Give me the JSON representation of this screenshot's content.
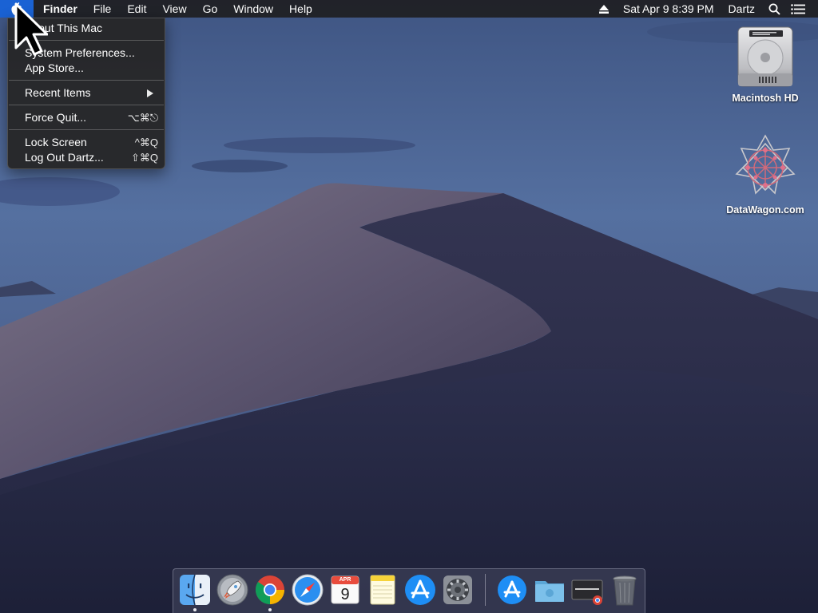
{
  "menubar": {
    "app_name": "Finder",
    "menus": [
      "File",
      "Edit",
      "View",
      "Go",
      "Window",
      "Help"
    ],
    "datetime": "Sat Apr 9  8:39 PM",
    "user": "Dartz"
  },
  "apple_menu": {
    "about": "About This Mac",
    "system_preferences": "System Preferences...",
    "app_store": "App Store...",
    "recent_items": "Recent Items",
    "force_quit": "Force Quit...",
    "force_quit_shortcut": "⌥⌘⎋",
    "lock_screen": "Lock Screen",
    "lock_screen_shortcut": "^⌘Q",
    "log_out": "Log Out Dartz...",
    "log_out_shortcut": "⇧⌘Q"
  },
  "desktop": {
    "hd_label": "Macintosh HD",
    "site_label": "DataWagon.com"
  },
  "dock": {
    "calendar_month": "APR",
    "calendar_day": "9"
  },
  "colors": {
    "menubar_highlight": "#1a62d4",
    "menubar_bg": "#1e1e22"
  }
}
